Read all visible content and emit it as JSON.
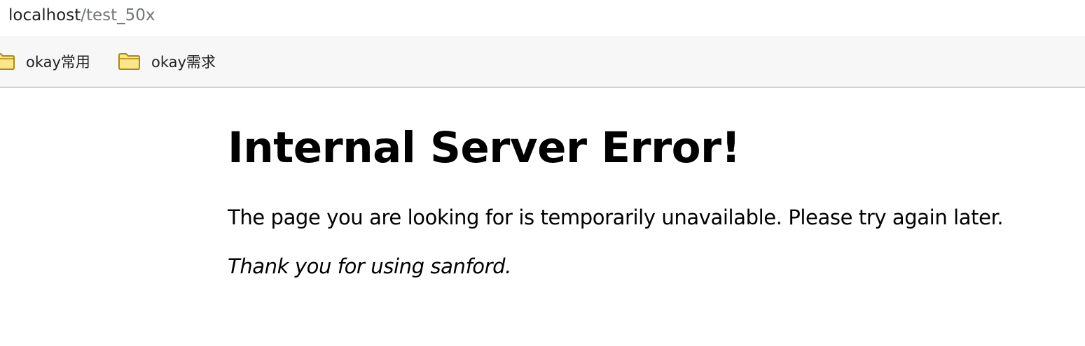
{
  "address_bar": {
    "host": "localhost",
    "path": "/test_50x"
  },
  "bookmarks": [
    {
      "label": "okay常用",
      "icon": "folder-icon"
    },
    {
      "label": "okay需求",
      "icon": "folder-icon"
    }
  ],
  "page": {
    "heading": "Internal Server Error!",
    "message": "The page you are looking for is temporarily unavailable. Please try again later.",
    "thanks": "Thank you for using sanford."
  },
  "colors": {
    "folder_fill": "#fde58a",
    "folder_stroke": "#b08a0e",
    "bookmark_bar_bg": "#f7f7f7",
    "url_path": "#70757a"
  }
}
